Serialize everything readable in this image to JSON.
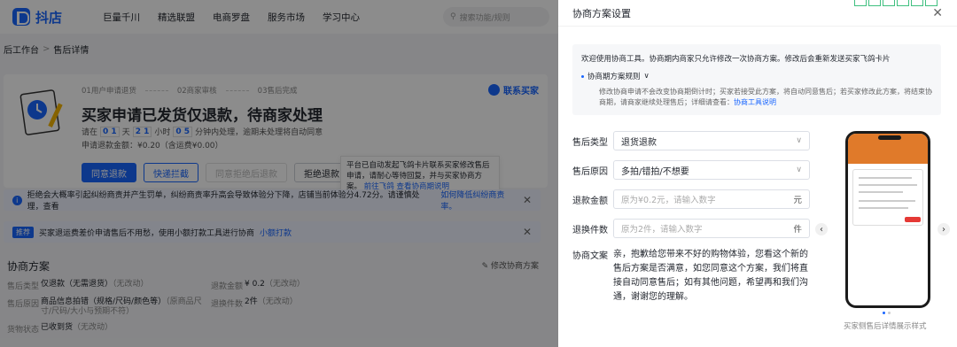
{
  "app": {
    "logo_text": "抖店"
  },
  "nav": [
    "巨量千川",
    "精选联盟",
    "电商罗盘",
    "服务市场",
    "学习中心"
  ],
  "search": {
    "placeholder": "搜索功能/规则"
  },
  "breadcrumb": {
    "parent": "后工作台",
    "current": "售后详情"
  },
  "steps": [
    "01用户申请退货",
    "02商家审核",
    "03售后完成"
  ],
  "status": {
    "title": "买家申请已发货仅退款，待商家处理",
    "countdown_prefix": "请在",
    "days": "0 1",
    "d_unit": "天",
    "hours": "2 1",
    "h_unit": "小时",
    "minutes": "0 5",
    "countdown_suffix": "分钟内处理，逾期未处理将自动同意",
    "refund_amount": "申请退款金额：¥0.20（含运费¥0.00）",
    "contact_buyer": "联系买家"
  },
  "actions": {
    "agree": "同意退款",
    "intercept": "快递拦截",
    "agree_reject_return": "同意拒绝后退款",
    "reject": "拒绝退款"
  },
  "tip": {
    "text": "平台已自动发起飞鸽卡片联系买家修改售后申请，请耐心等待回复，并与买家协商方案。",
    "link1": "前往飞鸽",
    "link2": "查看协商期说明"
  },
  "alerts": [
    {
      "text": "拒绝会大概率引起纠纷商责并产生罚单，纠纷商责率升高会导致体验分下降，店铺当前体验分4.72分。请谨慎处理，查看",
      "link": "如何降低纠纷商责率。"
    },
    {
      "tag": "推荐",
      "text": "买家退运费差价申请售后不用愁，使用小额打款工具进行协商",
      "link": "小额打款"
    }
  ],
  "plan": {
    "title": "协商方案",
    "edit": "修改协商方案",
    "rows": [
      [
        {
          "k": "售后类型",
          "v": "仅退款（无需退货）",
          "muted": "（无改动）"
        },
        {
          "k": "退款金额",
          "v": "¥ 0.2",
          "muted": "（无改动）"
        }
      ],
      [
        {
          "k": "售后原因",
          "v": "商品信息拍错（规格/尺码/颜色等）",
          "muted": "（原商品尺寸/尺码/大小与预期不符）"
        },
        {
          "k": "退换件数",
          "v": "2件",
          "muted": "（无改动）"
        }
      ],
      [
        {
          "k": "货物状态",
          "v": "已收到货",
          "muted": "（无改动）"
        }
      ]
    ]
  },
  "drawer": {
    "title": "协商方案设置",
    "notice_line1": "欢迎使用协商工具。协商期内商家只允许修改一次协商方案。修改后会重新发送买家飞鸽卡片",
    "rule_label": "协商期方案规则",
    "rule_detail": "修改协商申请不会改变协商期倒计时；买家若接受此方案，将自动同意售后；若买家修改此方案，将结束协商期，请商家继续处理售后；详细请查看：",
    "rule_link": "协商工具说明",
    "fields": {
      "type_label": "售后类型",
      "type_value": "退货退款",
      "reason_label": "售后原因",
      "reason_value": "多拍/错拍/不想要",
      "amount_label": "退款金额",
      "amount_placeholder": "原为¥0.2元，请输入数字",
      "amount_suffix": "元",
      "count_label": "退换件数",
      "count_placeholder": "原为2件，请输入数字",
      "count_suffix": "件",
      "message_label": "协商文案",
      "message_text": "亲，抱歉给您带来不好的购物体验，您看这个新的售后方案是否满意，如您同意这个方案，我们将直接自动同意售后；如有其他问题，希望再和我们沟通，谢谢您的理解。"
    },
    "preview_caption": "买家侧售后详情展示样式"
  },
  "colors": {
    "accent": "#1966ff",
    "overlay": "rgba(0,0,0,0.45)"
  }
}
